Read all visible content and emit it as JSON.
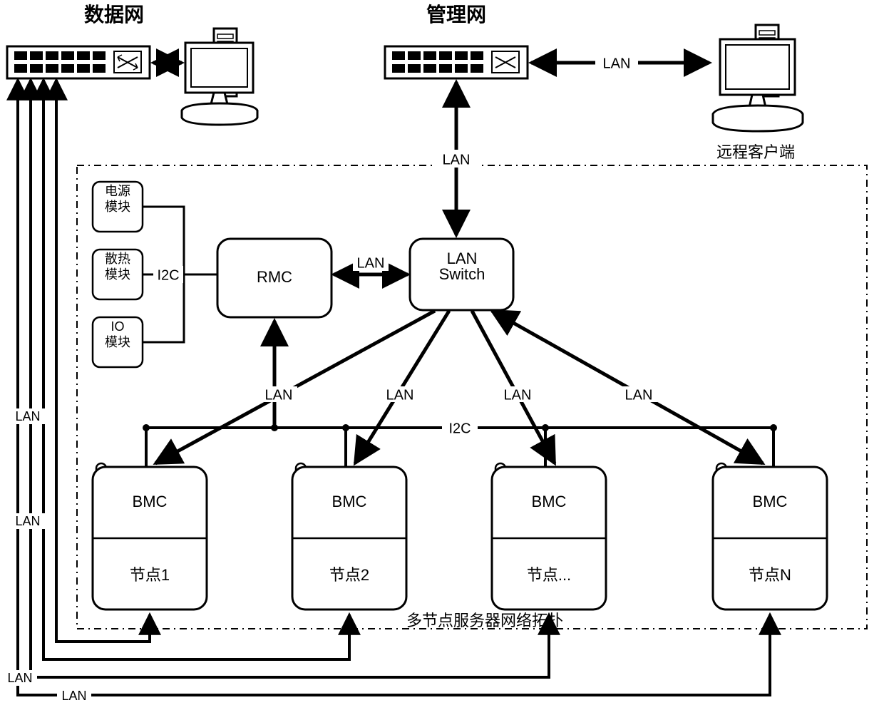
{
  "titles": {
    "data_net": "数据网",
    "mgmt_net": "管理网",
    "remote_client": "远程客户端"
  },
  "blocks": {
    "power_module": "电源\n模块",
    "cooling_module": "散热\n模块",
    "io_module": "IO\n模块",
    "rmc": "RMC",
    "lan_switch": "LAN\nSwitch",
    "bmc": "BMC",
    "node1": "节点1",
    "node2": "节点2",
    "node_ellipsis": "节点...",
    "nodeN": "节点N"
  },
  "links": {
    "lan": "LAN",
    "i2c": "I2C"
  },
  "caption": "多节点服务器网络拓扑"
}
